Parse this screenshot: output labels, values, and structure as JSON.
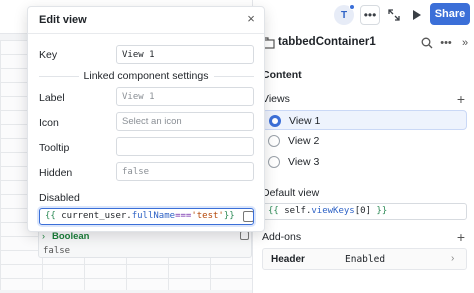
{
  "modal": {
    "title": "Edit view",
    "close_icon": "close-icon",
    "key": {
      "label": "Key",
      "value": "View 1"
    },
    "linked_section_title": "Linked component settings",
    "label": {
      "label": "Label",
      "placeholder": "View 1"
    },
    "icon": {
      "label": "Icon",
      "placeholder": "Select an icon"
    },
    "tooltip": {
      "label": "Tooltip",
      "value": ""
    },
    "hidden": {
      "label": "Hidden",
      "placeholder": "false"
    },
    "disabled": {
      "label": "Disabled",
      "open_brace": "{{",
      "expr_var": "current_user",
      "expr_dot": ".",
      "expr_prop": "fullName",
      "expr_op": "===",
      "expr_str": "'test'",
      "close_brace": "}}"
    },
    "eval": {
      "type": "Boolean",
      "value": "false"
    }
  },
  "toolbar": {
    "avatar_initial": "T",
    "more_icon": "more-horizontal-icon",
    "expand_icon": "expand-icon",
    "play_icon": "play-icon",
    "share_label": "Share"
  },
  "inspector": {
    "component_name": "tabbedContainer1",
    "content_title": "Content",
    "views_title": "Views",
    "views": [
      {
        "label": "View 1",
        "selected": true
      },
      {
        "label": "View 2",
        "selected": false
      },
      {
        "label": "View 3",
        "selected": false
      }
    ],
    "default_view_title": "Default view",
    "default_view": {
      "open_brace": "{{",
      "var": "self",
      "dot": ".",
      "prop": "viewKeys",
      "index": "[0]",
      "close_brace": "}}"
    },
    "addons_title": "Add-ons",
    "addons": [
      {
        "name": "Header",
        "status": "Enabled"
      }
    ]
  },
  "colors": {
    "accent": "#3b6fd8",
    "boolean_green": "#1b7f3b",
    "brace_green": "#2e8b57",
    "string_orange": "#b54708"
  }
}
